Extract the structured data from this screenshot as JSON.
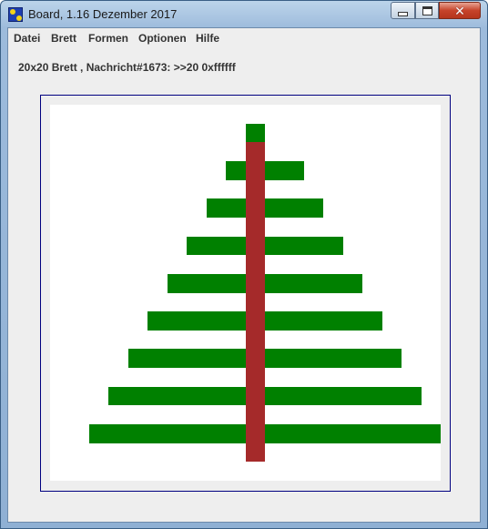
{
  "window": {
    "title": "Board, 1.16 Dezember 2017",
    "close_glyph": "✕"
  },
  "menu": {
    "items": [
      {
        "label": "Datei"
      },
      {
        "label": "Brett"
      },
      {
        "label": "Formen"
      },
      {
        "label": "Optionen"
      },
      {
        "label": "Hilfe"
      }
    ]
  },
  "status": {
    "text": "20x20 Brett , Nachricht#1673: >>20 0xffffff"
  },
  "board": {
    "background": "#ffffff",
    "border_color": "#000080",
    "colors": {
      "tree": "#008000",
      "trunk": "#a52a2a"
    },
    "rows": 20,
    "cols": 20,
    "tree_rows": [
      {
        "row": 1,
        "col_from": 10,
        "col_to": 10
      },
      {
        "row": 3,
        "col_from": 9,
        "col_to": 12
      },
      {
        "row": 5,
        "col_from": 8,
        "col_to": 13
      },
      {
        "row": 7,
        "col_from": 7,
        "col_to": 14
      },
      {
        "row": 9,
        "col_from": 6,
        "col_to": 15
      },
      {
        "row": 11,
        "col_from": 5,
        "col_to": 16
      },
      {
        "row": 13,
        "col_from": 4,
        "col_to": 17
      },
      {
        "row": 15,
        "col_from": 3,
        "col_to": 18
      },
      {
        "row": 17,
        "col_from": 2,
        "col_to": 19
      }
    ],
    "trunk": {
      "col": 10,
      "row_from": 2,
      "row_to": 18
    }
  }
}
